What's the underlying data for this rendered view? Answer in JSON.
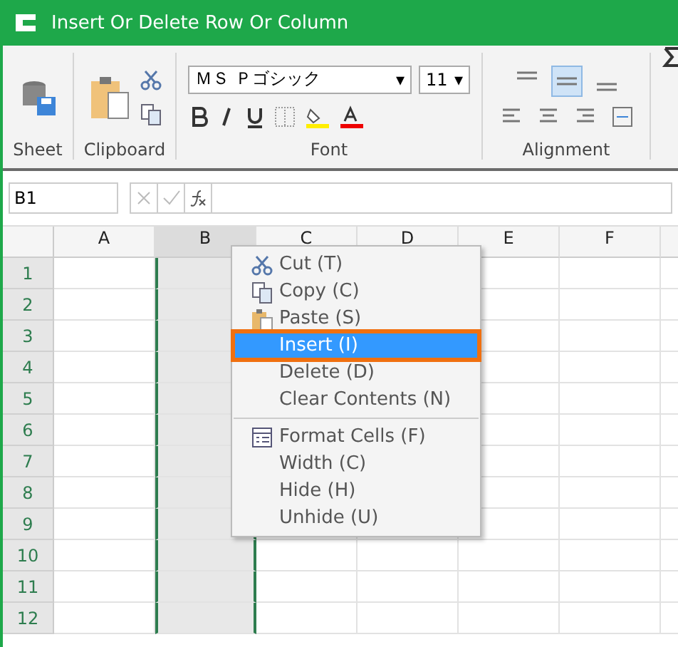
{
  "window": {
    "title": "Insert Or Delete Row Or Column"
  },
  "ribbon": {
    "groups": [
      "Sheet",
      "Clipboard",
      "Font",
      "Alignment"
    ],
    "font": {
      "name": "ＭＳ Ｐゴシック",
      "size": "11",
      "dropdown": "▾"
    },
    "alignment_buttons": [
      {
        "selected": false
      },
      {
        "selected": true
      },
      {
        "selected": false
      }
    ]
  },
  "name_box": {
    "value": "B1"
  },
  "columns": [
    {
      "label": "A",
      "selected": false
    },
    {
      "label": "B",
      "selected": true
    },
    {
      "label": "C",
      "selected": false
    },
    {
      "label": "D",
      "selected": false
    },
    {
      "label": "E",
      "selected": false
    },
    {
      "label": "F",
      "selected": false
    }
  ],
  "rows": [
    "1",
    "2",
    "3",
    "4",
    "5",
    "6",
    "7",
    "8",
    "9",
    "10",
    "11",
    "12"
  ],
  "context_menu": {
    "sections": [
      [
        {
          "label": "Cut (T)",
          "selected": false
        },
        {
          "label": "Copy (C)",
          "selected": false
        },
        {
          "label": "Paste (S)",
          "selected": false
        },
        {
          "label": "Insert (I)",
          "selected": true
        },
        {
          "label": "Delete (D)",
          "selected": false
        },
        {
          "label": "Clear Contents (N)",
          "selected": false
        }
      ],
      [
        {
          "label": "Format Cells (F)",
          "selected": false
        },
        {
          "label": "Width (C)",
          "selected": false
        },
        {
          "label": "Hide (H)",
          "selected": false
        },
        {
          "label": "Unhide (U)",
          "selected": false
        }
      ]
    ]
  }
}
